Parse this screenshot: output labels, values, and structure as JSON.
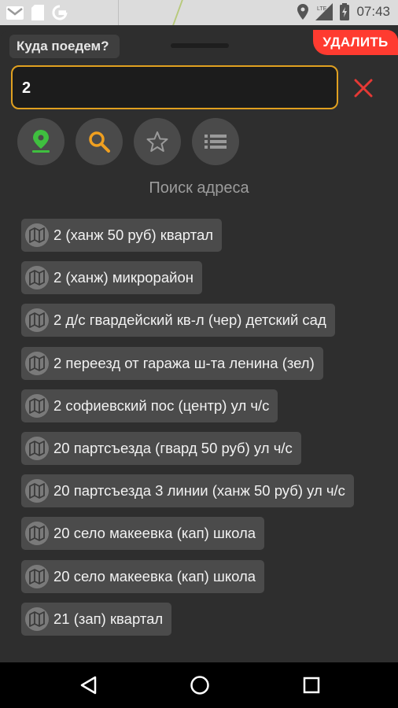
{
  "status_bar": {
    "icons": [
      "gmail-icon",
      "sd-card-icon",
      "google-icon",
      "location-icon",
      "signal-icon",
      "battery-icon"
    ],
    "network_label": "LTE",
    "time": "07:43"
  },
  "panel": {
    "title": "Куда поедем?",
    "delete_label": "УДАЛИТЬ"
  },
  "search": {
    "value": "2",
    "accent_color": "#e0a020"
  },
  "modes": [
    {
      "name": "map-pin-icon",
      "color": "#3fbf3f"
    },
    {
      "name": "search-icon",
      "color": "#f0a020"
    },
    {
      "name": "star-icon",
      "color": "#9a9a9a"
    },
    {
      "name": "list-icon",
      "color": "#9a9a9a"
    }
  ],
  "section_label": "Поиск адреса",
  "results": [
    {
      "label": "2 (ханж 50 руб) квартал"
    },
    {
      "label": "2 (ханж) микрорайон"
    },
    {
      "label": "2 д/с гвардейский кв-л (чер) детский сад"
    },
    {
      "label": "2 переезд от гаража ш-та ленина (зел)"
    },
    {
      "label": "2 софиевский пос (центр) ул ч/с"
    },
    {
      "label": "20 партсъезда (гвард 50 руб) ул ч/с"
    },
    {
      "label": "20 партсъезда 3 линии (ханж 50 руб) ул ч/с"
    },
    {
      "label": "20 село макеевка (кап) школа"
    },
    {
      "label": "20 село макеевка (кап) школа"
    },
    {
      "label": "21 (зап) квартал"
    }
  ],
  "nav_bar": {
    "buttons": [
      "back-icon",
      "home-icon",
      "recents-icon"
    ]
  }
}
